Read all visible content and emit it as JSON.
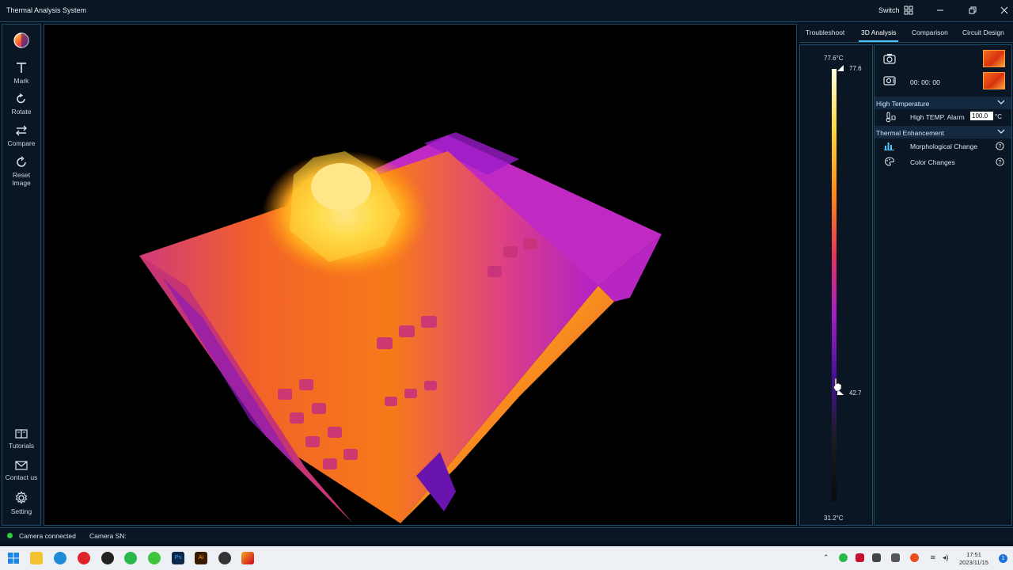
{
  "app": {
    "title": "Thermal Analysis System",
    "switch_label": "Switch",
    "accent_color": "#4ec6ff",
    "border_color": "#1e4a66"
  },
  "left_toolbar": {
    "items": [
      {
        "label": "",
        "icon": "palette-icon"
      },
      {
        "label": "Mark",
        "icon": "text-mark-icon"
      },
      {
        "label": "Rotate",
        "icon": "rotate-icon"
      },
      {
        "label": "Compare",
        "icon": "compare-arrows-icon"
      },
      {
        "label": "Reset Image",
        "icon": "reset-icon"
      }
    ],
    "bottom_items": [
      {
        "label": "Tutorials",
        "icon": "book-icon"
      },
      {
        "label": "Contact us",
        "icon": "mail-icon"
      },
      {
        "label": "Setting",
        "icon": "gear-icon"
      }
    ]
  },
  "tabs": [
    {
      "label": "Troubleshoot",
      "active": false
    },
    {
      "label": "3D Analysis",
      "active": true
    },
    {
      "label": "Comparison",
      "active": false
    },
    {
      "label": "Circuit Design",
      "active": false
    }
  ],
  "temperature_scale": {
    "max_label": "77.6°C",
    "min_label": "31.2°C",
    "upper_marker": "77.6",
    "lower_marker": "42.7",
    "colors": [
      "#ffffe0",
      "#ffd83a",
      "#ff8a12",
      "#e8345a",
      "#a21ec8",
      "#4a10a0",
      "#1c1c1c",
      "#0a0a0a"
    ]
  },
  "capture": {
    "photo_icon": "camera-icon",
    "record_icon": "video-record-icon",
    "record_time": "00: 00: 00"
  },
  "sections": {
    "high_temperature": {
      "title": "High Temperature",
      "alarm_label": "High TEMP. Alarm",
      "alarm_value": "100.0",
      "alarm_unit": "°C"
    },
    "thermal_enhancement": {
      "title": "Thermal Enhancement",
      "options": [
        {
          "label": "Morphological Change",
          "icon": "bar-chart-icon"
        },
        {
          "label": "Color Changes",
          "icon": "color-palette-icon"
        }
      ]
    }
  },
  "status": {
    "connection": "Camera connected",
    "serial_label": "Camera SN:"
  },
  "taskbar": {
    "clock_time": "17:51",
    "clock_date": "2023/11/15",
    "notification_count": "1"
  }
}
